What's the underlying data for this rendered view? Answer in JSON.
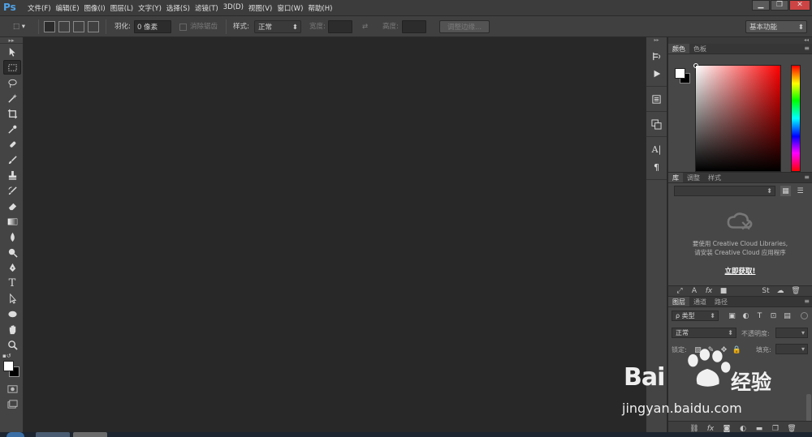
{
  "app": {
    "logo": "Ps"
  },
  "menu": [
    "文件(F)",
    "编辑(E)",
    "图像(I)",
    "图层(L)",
    "文字(Y)",
    "选择(S)",
    "滤镜(T)",
    "3D(D)",
    "视图(V)",
    "窗口(W)",
    "帮助(H)"
  ],
  "window_controls": {
    "minimize": "▁",
    "restore": "❐",
    "close": "✕"
  },
  "options": {
    "feather_label": "羽化:",
    "feather_value": "0 像素",
    "antialias_label": "消除锯齿",
    "style_label": "样式:",
    "style_value": "正常",
    "width_label": "宽度:",
    "width_value": "",
    "height_label": "高度:",
    "height_value": "",
    "refine_edge_button": "调整边缘...",
    "workspace": "基本功能"
  },
  "toolbar_icons": [
    "move-icon",
    "marquee-icon",
    "lasso-icon",
    "quick-select-icon",
    "crop-icon",
    "eyedropper-icon",
    "healing-brush-icon",
    "brush-icon",
    "clone-stamp-icon",
    "history-brush-icon",
    "eraser-icon",
    "gradient-icon",
    "blur-icon",
    "dodge-icon",
    "pen-icon",
    "type-icon",
    "path-select-icon",
    "ellipse-icon",
    "hand-icon",
    "zoom-icon"
  ],
  "panels": {
    "color": {
      "tabs": [
        "颜色",
        "色板"
      ],
      "foreground": "#ffffff",
      "background": "#000000"
    },
    "library": {
      "tabs": [
        "库",
        "调整",
        "样式"
      ],
      "message_line1": "要使用 Creative Cloud Libraries,",
      "message_line2": "请安装 Creative Cloud 应用程序",
      "link": "立即获取!"
    },
    "layers": {
      "tabs": [
        "图层",
        "通道",
        "路径"
      ],
      "filter_kind": "ρ 类型",
      "blend_mode": "正常",
      "opacity_label": "不透明度:",
      "lock_label": "锁定:",
      "fill_label": "填充:"
    }
  },
  "watermark": {
    "brand": "Bai",
    "brand_cn": "经验",
    "url": "jingyan.baidu.com"
  }
}
